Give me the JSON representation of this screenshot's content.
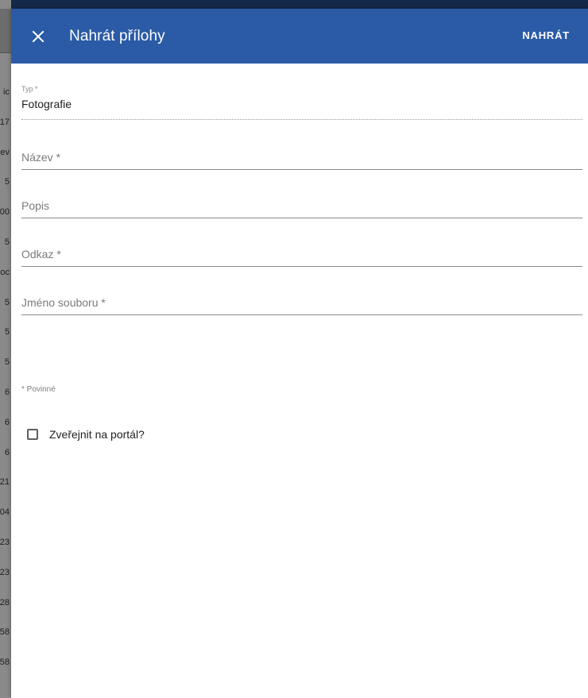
{
  "background": {
    "edge_numbers": [
      "ic",
      "17",
      "ev",
      "5",
      "00",
      "5",
      "oc",
      "5",
      "5",
      "5",
      "6",
      "6",
      "6",
      "21",
      "04",
      "23",
      "23",
      "28",
      "58",
      "58"
    ]
  },
  "dialog": {
    "title": "Nahrát přílohy",
    "close_icon": "close-icon",
    "upload_label": "NAHRÁT",
    "colors": {
      "toolbar": "#2b5ba6",
      "text_on_toolbar": "#ffffff"
    }
  },
  "form": {
    "type_field": {
      "label": "Typ *",
      "value": "Fotografie"
    },
    "name_field": {
      "placeholder": "Název *",
      "value": ""
    },
    "description_field": {
      "placeholder": "Popis",
      "value": ""
    },
    "link_field": {
      "placeholder": "Odkaz *",
      "value": ""
    },
    "filename_field": {
      "placeholder": "Jméno souboru *",
      "value": ""
    },
    "required_note": "* Povinné",
    "publish_checkbox": {
      "label": "Zveřejnit na portál?",
      "checked": false
    }
  }
}
